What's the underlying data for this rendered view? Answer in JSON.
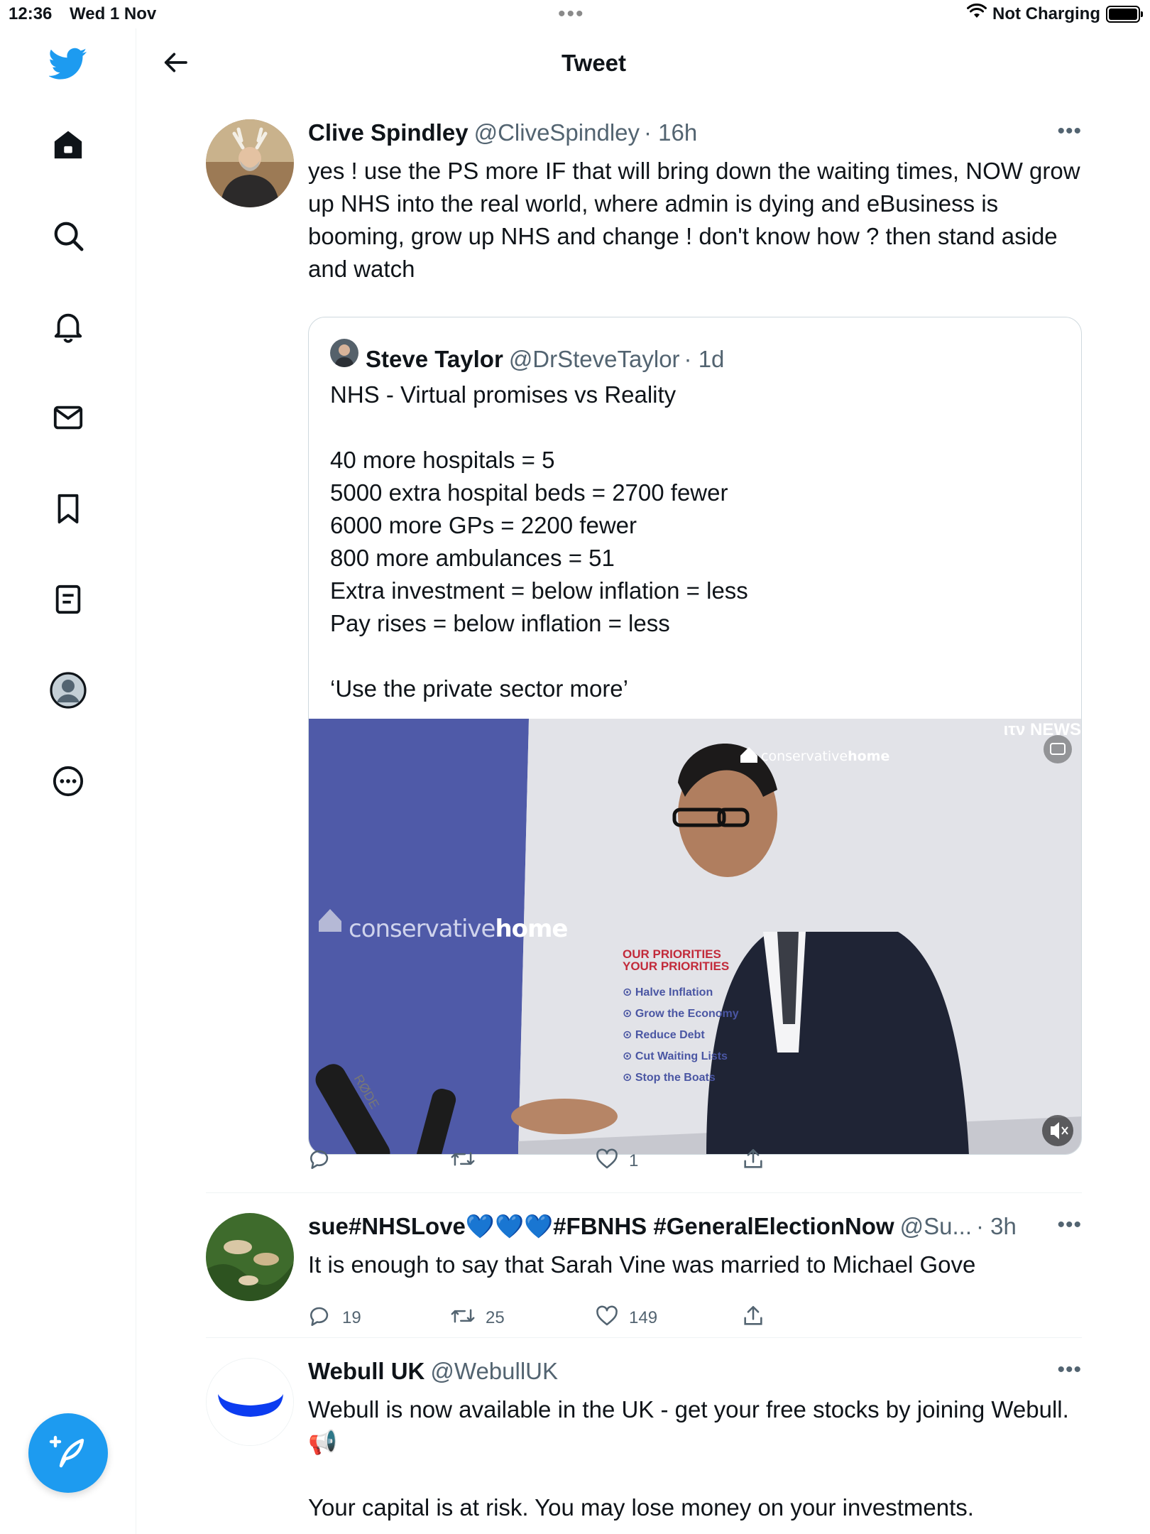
{
  "status_bar": {
    "time": "12:36",
    "date": "Wed 1 Nov",
    "dots": "•••",
    "charging": "Not Charging"
  },
  "header": {
    "title": "Tweet"
  },
  "icons": {
    "brand": "twitter-bird-icon",
    "nav": [
      "home-icon",
      "search-icon",
      "bell-icon",
      "mail-icon",
      "bookmark-icon",
      "lists-icon",
      "profile-icon",
      "more-circle-icon"
    ],
    "compose": "compose-icon"
  },
  "colors": {
    "accent": "#1d9bf0",
    "secondary_text": "#536471",
    "border": "#cfd9de"
  },
  "main_tweet": {
    "name": "Clive Spindley",
    "handle": "@CliveSpindley",
    "time": "· 16h",
    "text": "yes ! use the PS more IF that will bring down the waiting times, NOW grow up NHS into the real world, where admin is dying and eBusiness is booming, grow up NHS and change ! don't know how ? then stand aside and watch",
    "more": "•••",
    "quote": {
      "name": "Steve Taylor",
      "handle": "@DrSteveTaylor",
      "time": "· 1d",
      "text": "NHS - Virtual promises vs Reality\n\n40 more hospitals = 5\n5000 extra hospital beds = 2700 fewer\n6000 more GPs = 2200 fewer\n800 more ambulances = 51\nExtra investment = below inflation = less\nPay rises = below inflation = less\n\n‘Use the private sector more’",
      "video": {
        "itv_logo": "ιτν NEWS",
        "watermark_light": "conservative",
        "watermark_bold": "home",
        "board_title_1": "OUR PRIORITIES",
        "board_title_2": "YOUR PRIORITIES",
        "priorities": [
          "Halve Inflation",
          "Grow the Economy",
          "Reduce Debt",
          "Cut Waiting Lists",
          "Stop the Boats"
        ],
        "mic_brand": "RØDE"
      }
    },
    "actions": {
      "replies": "",
      "retweets": "",
      "likes": "1"
    }
  },
  "replies": [
    {
      "name": "sue#NHSLove💙💙💙#FBNHS #GeneralElectionNow",
      "handle": "@Su...",
      "time": "· 3h",
      "text": "It is enough to say that Sarah Vine was married to Michael Gove",
      "more": "•••",
      "actions": {
        "replies": "19",
        "retweets": "25",
        "likes": "149"
      }
    },
    {
      "name": "Webull UK",
      "handle": "@WebullUK",
      "time": "",
      "text": "Webull is now available in the UK - get your free stocks by joining Webull. 📢\n\nYour capital is at risk. You may lose money on your investments.",
      "more": "•••"
    }
  ]
}
